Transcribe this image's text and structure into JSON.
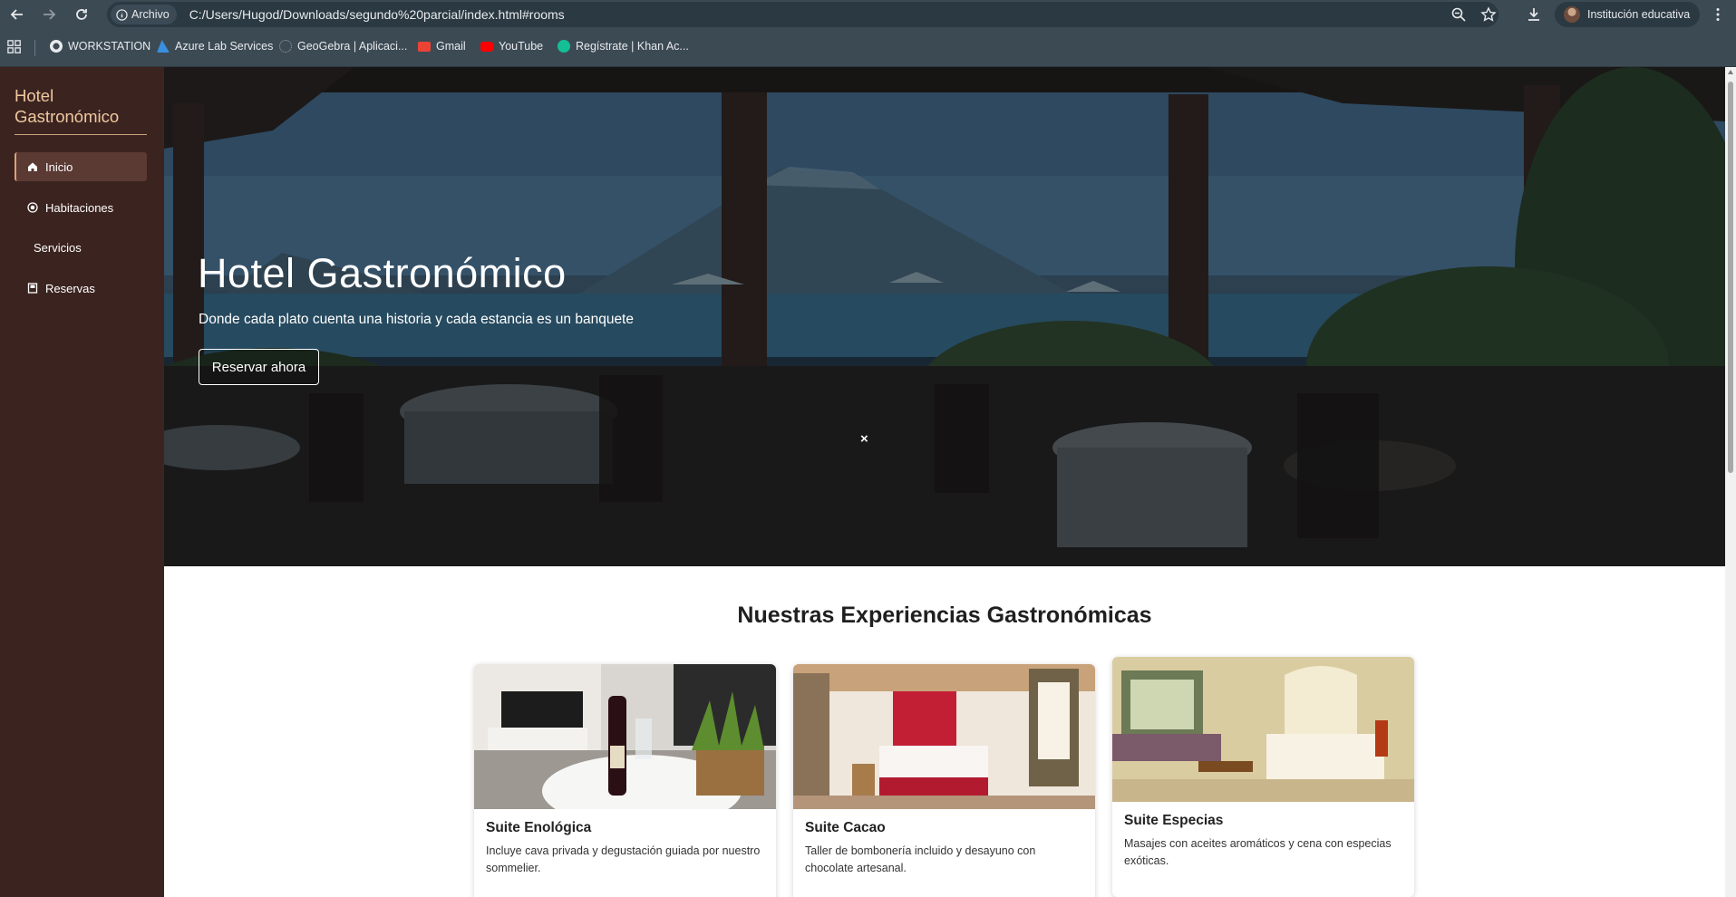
{
  "browser": {
    "site_chip": "Archivo",
    "url": "C:/Users/Hugod/Downloads/segundo%20parcial/index.html#rooms",
    "profile": "Institución educativa",
    "bookmarks": [
      {
        "label": "WORKSTATION",
        "icon": "globe-icon",
        "color": "#e8eaed"
      },
      {
        "label": "Azure Lab Services",
        "icon": "azure-icon",
        "color": "#3a8fe0"
      },
      {
        "label": "GeoGebra | Aplicaci...",
        "icon": "geogebra-icon",
        "color": "#9aa0a6"
      },
      {
        "label": "Gmail",
        "icon": "gmail-icon",
        "color": "#ea4335"
      },
      {
        "label": "YouTube",
        "icon": "youtube-icon",
        "color": "#ff0000"
      },
      {
        "label": "Regístrate | Khan Ac...",
        "icon": "khan-icon",
        "color": "#14bf96"
      }
    ]
  },
  "sidebar": {
    "brand": "Hotel Gastronómico",
    "items": [
      {
        "label": "Inicio",
        "icon": "home-icon",
        "active": true
      },
      {
        "label": "Habitaciones",
        "icon": "bed-icon",
        "active": false
      },
      {
        "label": "Servicios",
        "icon": "",
        "active": false
      },
      {
        "label": "Reservas",
        "icon": "book-icon",
        "active": false
      }
    ]
  },
  "hero": {
    "title": "Hotel Gastronómico",
    "subtitle": "Donde cada plato cuenta una historia y cada estancia es un banquete",
    "button": "Reservar ahora",
    "close": "×"
  },
  "rooms": {
    "title": "Nuestras Experiencias Gastronómicas",
    "cards": [
      {
        "name": "Suite Enológica",
        "description": "Incluye cava privada y degustación guiada por nuestro sommelier.",
        "image": "wine-room-photo"
      },
      {
        "name": "Suite Cacao",
        "description": "Taller de bombonería incluido y desayuno con chocolate artesanal.",
        "image": "cacao-room-photo"
      },
      {
        "name": "Suite Especias",
        "description": "Masajes con aceites aromáticos y cena con especias exóticas.",
        "image": "spice-room-photo"
      }
    ]
  },
  "colors": {
    "sidebar_bg": "#3b2420",
    "brand": "#f0c8a0",
    "chrome": "#3c4a54"
  }
}
